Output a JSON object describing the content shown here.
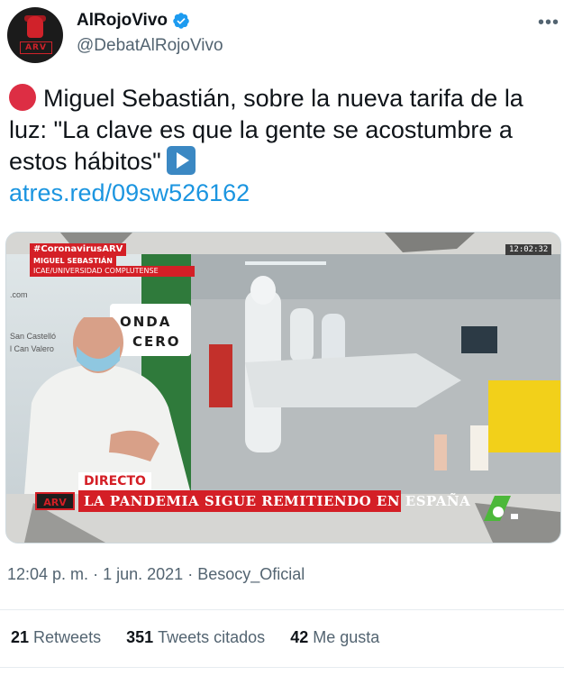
{
  "user": {
    "display_name": "AlRojoVivo",
    "handle": "@DebatAlRojoVivo",
    "verified": true,
    "avatar_logo_text": "ARV"
  },
  "menu": {
    "more_label": "•••"
  },
  "tweet": {
    "text": "Miguel Sebastián, sobre la nueva tarifa de la luz: \"La clave es que la gente se acostumbre a estos hábitos\"",
    "link": "atres.red/09sw526162",
    "leading_emoji": "red-circle-icon",
    "trailing_emoji": "play-button-icon"
  },
  "media": {
    "hashtag_tag": "#CoronavirusARV",
    "guest_name": "MIGUEL SEBASTIÁN",
    "guest_role": "ICAE/UNIVERSIDAD COMPLUTENSE",
    "clock": "12:02:32",
    "live_label": "DIRECTO",
    "ticker_logo": "ARV",
    "ticker_text": "LA PANDEMIA SIGUE REMITIENDO EN ESPAÑA",
    "studio_sign_1": "ONDA",
    "studio_sign_2": "CERO",
    "studio_small_1": ".com",
    "studio_small_2": "San Castelló",
    "studio_small_3": "l Can Valero",
    "channel_badge": "la Sexta"
  },
  "meta": {
    "time": "12:04 p. m.",
    "separator": "·",
    "date": "1 jun. 2021",
    "source": "Besocy_Oficial"
  },
  "stats": {
    "retweets_count": "21",
    "retweets_label": "Retweets",
    "quotes_count": "351",
    "quotes_label": "Tweets citados",
    "likes_count": "42",
    "likes_label": "Me gusta"
  },
  "colors": {
    "link": "#1b95e0",
    "brand_red": "#d41f26",
    "verified_blue": "#1d9bf0",
    "secondary_text": "#536471"
  }
}
